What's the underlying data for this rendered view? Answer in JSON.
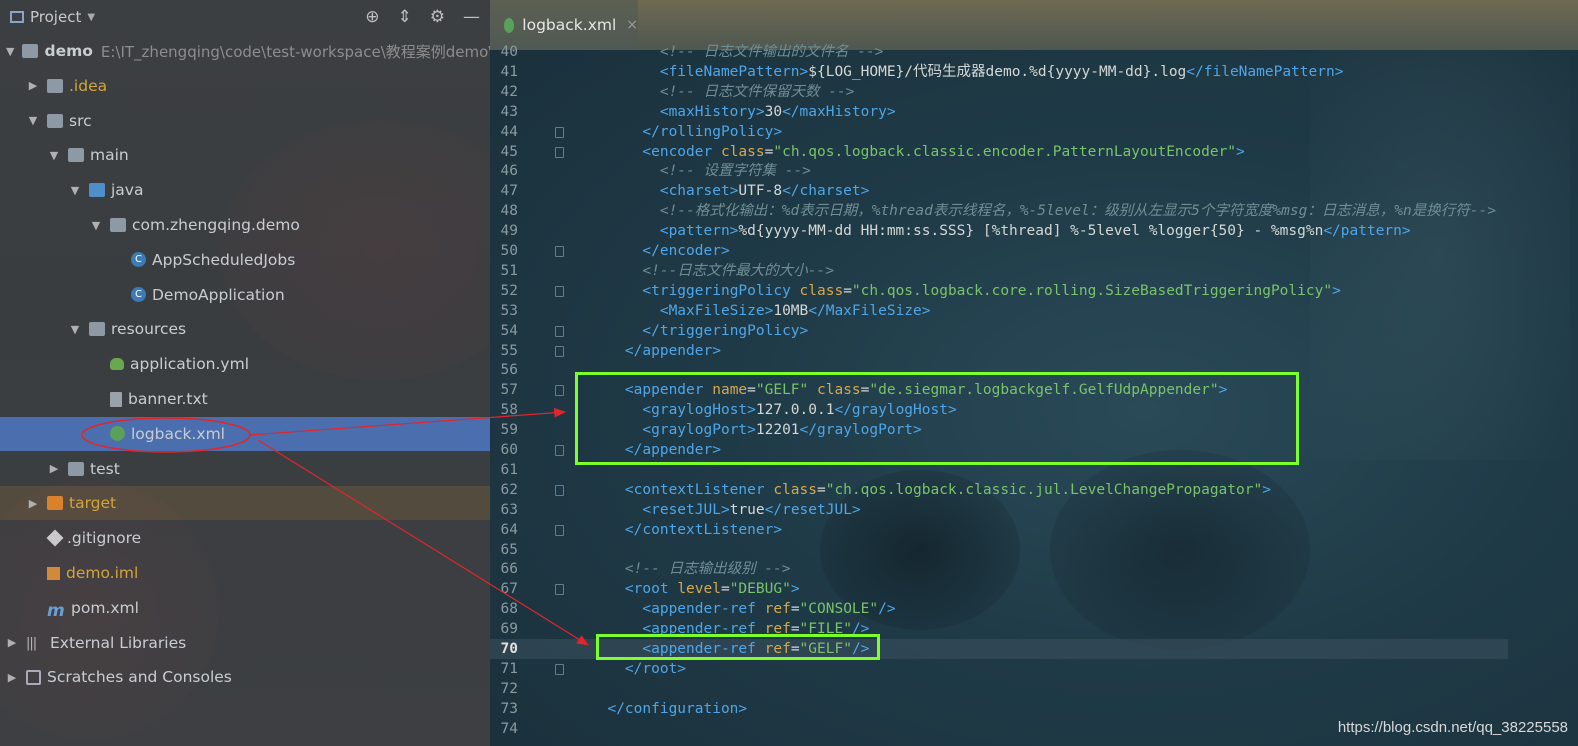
{
  "project": {
    "title": "Project",
    "tools": [
      "target-icon",
      "collapse-icon",
      "gear-icon",
      "minimize-icon"
    ],
    "tree": [
      {
        "label": "demo",
        "path": "E:\\IT_zhengqing\\code\\test-workspace\\教程案例demo\\d",
        "icon": "module-folder-icon",
        "depth": 0,
        "arrow": "▼"
      },
      {
        "label": ".idea",
        "icon": "folder-icon",
        "depth": 1,
        "arrow": "▶",
        "orange": true
      },
      {
        "label": "src",
        "icon": "folder-icon",
        "depth": 1,
        "arrow": "▼"
      },
      {
        "label": "main",
        "icon": "folder-icon",
        "depth": 2,
        "arrow": "▼"
      },
      {
        "label": "java",
        "icon": "source-folder-icon",
        "depth": 3,
        "arrow": "▼"
      },
      {
        "label": "com.zhengqing.demo",
        "icon": "package-icon",
        "depth": 4,
        "arrow": "▼"
      },
      {
        "label": "AppScheduledJobs",
        "icon": "class-icon",
        "depth": 5,
        "arrow": ""
      },
      {
        "label": "DemoApplication",
        "icon": "spring-class-icon",
        "depth": 5,
        "arrow": ""
      },
      {
        "label": "resources",
        "icon": "resources-folder-icon",
        "depth": 3,
        "arrow": "▼"
      },
      {
        "label": "application.yml",
        "icon": "yaml-file-icon",
        "depth": 4,
        "arrow": ""
      },
      {
        "label": "banner.txt",
        "icon": "text-file-icon",
        "depth": 4,
        "arrow": ""
      },
      {
        "label": "logback.xml",
        "icon": "xml-file-icon",
        "depth": 4,
        "arrow": "",
        "selected": true
      },
      {
        "label": "test",
        "icon": "folder-icon",
        "depth": 2,
        "arrow": "▶"
      },
      {
        "label": "target",
        "icon": "excluded-folder-icon",
        "depth": 1,
        "arrow": "▶",
        "excluded": true
      },
      {
        "label": ".gitignore",
        "icon": "gitignore-file-icon",
        "depth": 1,
        "arrow": ""
      },
      {
        "label": "demo.iml",
        "icon": "iml-file-icon",
        "depth": 1,
        "arrow": "",
        "orange": true
      },
      {
        "label": "pom.xml",
        "icon": "maven-file-icon",
        "depth": 1,
        "arrow": ""
      },
      {
        "label": "External Libraries",
        "icon": "libraries-icon",
        "depth": 0,
        "arrow": "▶"
      },
      {
        "label": "Scratches and Consoles",
        "icon": "scratches-icon",
        "depth": 0,
        "arrow": "▶"
      }
    ]
  },
  "editor": {
    "tab": {
      "label": "logback.xml",
      "close": "×"
    },
    "current_line": 70,
    "lines": [
      {
        "n": 40,
        "segs": [
          [
            "c",
            "        <!-- 日志文件输出的文件名 -->"
          ]
        ]
      },
      {
        "n": 41,
        "segs": [
          [
            "p",
            "        "
          ],
          [
            "t",
            "<fileNamePattern>"
          ],
          [
            "p",
            "${LOG_HOME}/代码生成器demo.%d{yyyy-MM-dd}.log"
          ],
          [
            "t",
            "</fileNamePattern>"
          ]
        ]
      },
      {
        "n": 42,
        "segs": [
          [
            "c",
            "        <!-- 日志文件保留天数 -->"
          ]
        ]
      },
      {
        "n": 43,
        "segs": [
          [
            "p",
            "        "
          ],
          [
            "t",
            "<maxHistory>"
          ],
          [
            "p",
            "30"
          ],
          [
            "t",
            "</maxHistory>"
          ]
        ]
      },
      {
        "n": 44,
        "segs": [
          [
            "p",
            "      "
          ],
          [
            "t",
            "</rollingPolicy>"
          ]
        ]
      },
      {
        "n": 45,
        "segs": [
          [
            "p",
            "      "
          ],
          [
            "t",
            "<encoder "
          ],
          [
            "a",
            "class"
          ],
          [
            "p",
            "="
          ],
          [
            "v",
            "\"ch.qos.logback.classic.encoder.PatternLayoutEncoder\""
          ],
          [
            "t",
            ">"
          ]
        ]
      },
      {
        "n": 46,
        "segs": [
          [
            "c",
            "        <!-- 设置字符集 -->"
          ]
        ]
      },
      {
        "n": 47,
        "segs": [
          [
            "p",
            "        "
          ],
          [
            "t",
            "<charset>"
          ],
          [
            "p",
            "UTF-8"
          ],
          [
            "t",
            "</charset>"
          ]
        ]
      },
      {
        "n": 48,
        "segs": [
          [
            "c",
            "        <!--格式化输出：%d表示日期，%thread表示线程名，%-5level：级别从左显示5个字符宽度%msg：日志消息，%n是换行符-->"
          ]
        ]
      },
      {
        "n": 49,
        "segs": [
          [
            "p",
            "        "
          ],
          [
            "t",
            "<pattern>"
          ],
          [
            "p",
            "%d{yyyy-MM-dd HH:mm:ss.SSS} [%thread] %-5level %logger{50} - %msg%n"
          ],
          [
            "t",
            "</pattern>"
          ]
        ]
      },
      {
        "n": 50,
        "segs": [
          [
            "p",
            "      "
          ],
          [
            "t",
            "</encoder>"
          ]
        ]
      },
      {
        "n": 51,
        "segs": [
          [
            "c",
            "      <!--日志文件最大的大小-->"
          ]
        ]
      },
      {
        "n": 52,
        "segs": [
          [
            "p",
            "      "
          ],
          [
            "t",
            "<triggeringPolicy "
          ],
          [
            "a",
            "class"
          ],
          [
            "p",
            "="
          ],
          [
            "v",
            "\"ch.qos.logback.core.rolling.SizeBasedTriggeringPolicy\""
          ],
          [
            "t",
            ">"
          ]
        ]
      },
      {
        "n": 53,
        "segs": [
          [
            "p",
            "        "
          ],
          [
            "t",
            "<MaxFileSize>"
          ],
          [
            "p",
            "10MB"
          ],
          [
            "t",
            "</MaxFileSize>"
          ]
        ]
      },
      {
        "n": 54,
        "segs": [
          [
            "p",
            "      "
          ],
          [
            "t",
            "</triggeringPolicy>"
          ]
        ]
      },
      {
        "n": 55,
        "segs": [
          [
            "p",
            "    "
          ],
          [
            "t",
            "</appender>"
          ]
        ]
      },
      {
        "n": 56,
        "segs": []
      },
      {
        "n": 57,
        "segs": [
          [
            "p",
            "    "
          ],
          [
            "t",
            "<appender "
          ],
          [
            "a",
            "name"
          ],
          [
            "p",
            "="
          ],
          [
            "v",
            "\"GELF\" "
          ],
          [
            "a",
            "class"
          ],
          [
            "p",
            "="
          ],
          [
            "v",
            "\"de.siegmar.logbackgelf.GelfUdpAppender\""
          ],
          [
            "t",
            ">"
          ]
        ]
      },
      {
        "n": 58,
        "segs": [
          [
            "p",
            "      "
          ],
          [
            "t",
            "<graylogHost>"
          ],
          [
            "p",
            "127.0.0.1"
          ],
          [
            "t",
            "</graylogHost>"
          ]
        ]
      },
      {
        "n": 59,
        "segs": [
          [
            "p",
            "      "
          ],
          [
            "t",
            "<graylogPort>"
          ],
          [
            "p",
            "12201"
          ],
          [
            "t",
            "</graylogPort>"
          ]
        ]
      },
      {
        "n": 60,
        "segs": [
          [
            "p",
            "    "
          ],
          [
            "t",
            "</appender>"
          ]
        ]
      },
      {
        "n": 61,
        "segs": []
      },
      {
        "n": 62,
        "segs": [
          [
            "p",
            "    "
          ],
          [
            "t",
            "<contextListener "
          ],
          [
            "a",
            "class"
          ],
          [
            "p",
            "="
          ],
          [
            "v",
            "\"ch.qos.logback.classic.jul.LevelChangePropagator\""
          ],
          [
            "t",
            ">"
          ]
        ]
      },
      {
        "n": 63,
        "segs": [
          [
            "p",
            "      "
          ],
          [
            "t",
            "<resetJUL>"
          ],
          [
            "p",
            "true"
          ],
          [
            "t",
            "</resetJUL>"
          ]
        ]
      },
      {
        "n": 64,
        "segs": [
          [
            "p",
            "    "
          ],
          [
            "t",
            "</contextListener>"
          ]
        ]
      },
      {
        "n": 65,
        "segs": []
      },
      {
        "n": 66,
        "segs": [
          [
            "c",
            "    <!-- 日志输出级别 -->"
          ]
        ]
      },
      {
        "n": 67,
        "segs": [
          [
            "p",
            "    "
          ],
          [
            "t",
            "<root "
          ],
          [
            "a",
            "level"
          ],
          [
            "p",
            "="
          ],
          [
            "v",
            "\"DEBUG\""
          ],
          [
            "t",
            ">"
          ]
        ]
      },
      {
        "n": 68,
        "segs": [
          [
            "p",
            "      "
          ],
          [
            "t",
            "<appender-ref "
          ],
          [
            "a",
            "ref"
          ],
          [
            "p",
            "="
          ],
          [
            "v",
            "\"CONSOLE\""
          ],
          [
            "t",
            "/>"
          ]
        ]
      },
      {
        "n": 69,
        "segs": [
          [
            "p",
            "      "
          ],
          [
            "t",
            "<appender-ref "
          ],
          [
            "a",
            "ref"
          ],
          [
            "p",
            "="
          ],
          [
            "v",
            "\"FILE\""
          ],
          [
            "t",
            "/>"
          ]
        ]
      },
      {
        "n": 70,
        "segs": [
          [
            "p",
            "      "
          ],
          [
            "t",
            "<appender-ref "
          ],
          [
            "a",
            "ref"
          ],
          [
            "p",
            "="
          ],
          [
            "v",
            "\"GELF\""
          ],
          [
            "t",
            "/>"
          ]
        ]
      },
      {
        "n": 71,
        "segs": [
          [
            "p",
            "    "
          ],
          [
            "t",
            "</root>"
          ]
        ]
      },
      {
        "n": 72,
        "segs": []
      },
      {
        "n": 73,
        "segs": [
          [
            "p",
            "  "
          ],
          [
            "t",
            "</configuration>"
          ]
        ]
      },
      {
        "n": 74,
        "segs": []
      }
    ]
  },
  "watermark": "https://blog.csdn.net/qq_38225558",
  "colors": {
    "annotation_red": "#e0262b",
    "highlight_green": "#7cff2a",
    "selection": "#4b6eaf"
  }
}
